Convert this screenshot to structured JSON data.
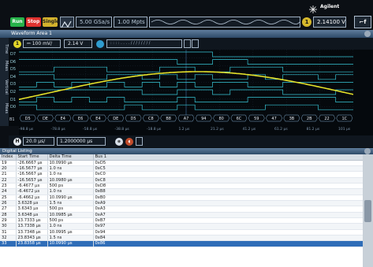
{
  "toolbar": {
    "run_label": "Run",
    "stop_label": "Stop",
    "single_label": "Single",
    "sample_rate": "5.00 GSa/s",
    "memory_depth": "1.00 Mpts",
    "brand": "Agilent",
    "trigger_level": "2.14100 V",
    "trigger_source": "1",
    "colors": {
      "run": "#27b24a",
      "stop": "#e0322f",
      "single": "#d3b22d"
    }
  },
  "waveform_area": {
    "title": "Waveform Area 1",
    "channel": "1",
    "scale": "100 mV/",
    "offset": "2.14 V",
    "side_tabs": [
      "Time",
      "Meas",
      "Vertical",
      "Meas"
    ],
    "digital_channels": [
      "D7",
      "D6",
      "D5",
      "D4",
      "D3",
      "D2",
      "D1",
      "D0"
    ],
    "bus_label": "B1",
    "bus_values": [
      "D5",
      "DE",
      "E4",
      "E6",
      "E4",
      "DE",
      "D5",
      "C8",
      "B8",
      "A7",
      "94",
      "80",
      "6C",
      "59",
      "47",
      "3B",
      "2B",
      "22",
      "1C"
    ],
    "time_ticks": [
      "-98.8 µs",
      "-78.8 µs",
      "-58.8 µs",
      "-38.8 µs",
      "-18.8 µs",
      "1.2 µs",
      "21.2 µs",
      "41.2 µs",
      "61.2 µs",
      "81.2 µs",
      "101 µs"
    ],
    "timebase": "20.0 µs/",
    "delay": "1.2000000 µs",
    "colors": {
      "analog": "#e5e12a",
      "digital": "#38c8d8",
      "bus": "#7fa8c8"
    }
  },
  "digital_listing": {
    "title": "Digital Listing",
    "columns": [
      "Index",
      "Start Time",
      "Delta Time",
      "Bus 1"
    ],
    "rows": [
      [
        "19",
        "-26.6667 µs",
        "10.0990 µs",
        "0xD5"
      ],
      [
        "20",
        "-16.5677 µs",
        "1.0 ns",
        "0xC5"
      ],
      [
        "21",
        "-16.5667 µs",
        "1.0 ns",
        "0xC0"
      ],
      [
        "22",
        "-16.5657 µs",
        "10.0980 µs",
        "0xC8"
      ],
      [
        "23",
        "-6.4677 µs",
        "500 ps",
        "0xD8"
      ],
      [
        "24",
        "-6.4672 µs",
        "1.0 ns",
        "0xB8"
      ],
      [
        "25",
        "-6.4662 µs",
        "10.0990 µs",
        "0xB0"
      ],
      [
        "26",
        "3.6328 µs",
        "1.5 ns",
        "0xA9"
      ],
      [
        "27",
        "3.6343 µs",
        "500 ps",
        "0xA3"
      ],
      [
        "28",
        "3.6348 µs",
        "10.0985 µs",
        "0xA7"
      ],
      [
        "29",
        "13.7333 µs",
        "500 ps",
        "0xB7"
      ],
      [
        "30",
        "13.7338 µs",
        "1.0 ns",
        "0x97"
      ],
      [
        "31",
        "13.7348 µs",
        "10.0995 µs",
        "0x94"
      ],
      [
        "32",
        "23.8343 µs",
        "1.5 ns",
        "0x84"
      ],
      [
        "33",
        "23.8358 µs",
        "10.0990 µs",
        "0x86"
      ]
    ],
    "selected_index": "33"
  }
}
